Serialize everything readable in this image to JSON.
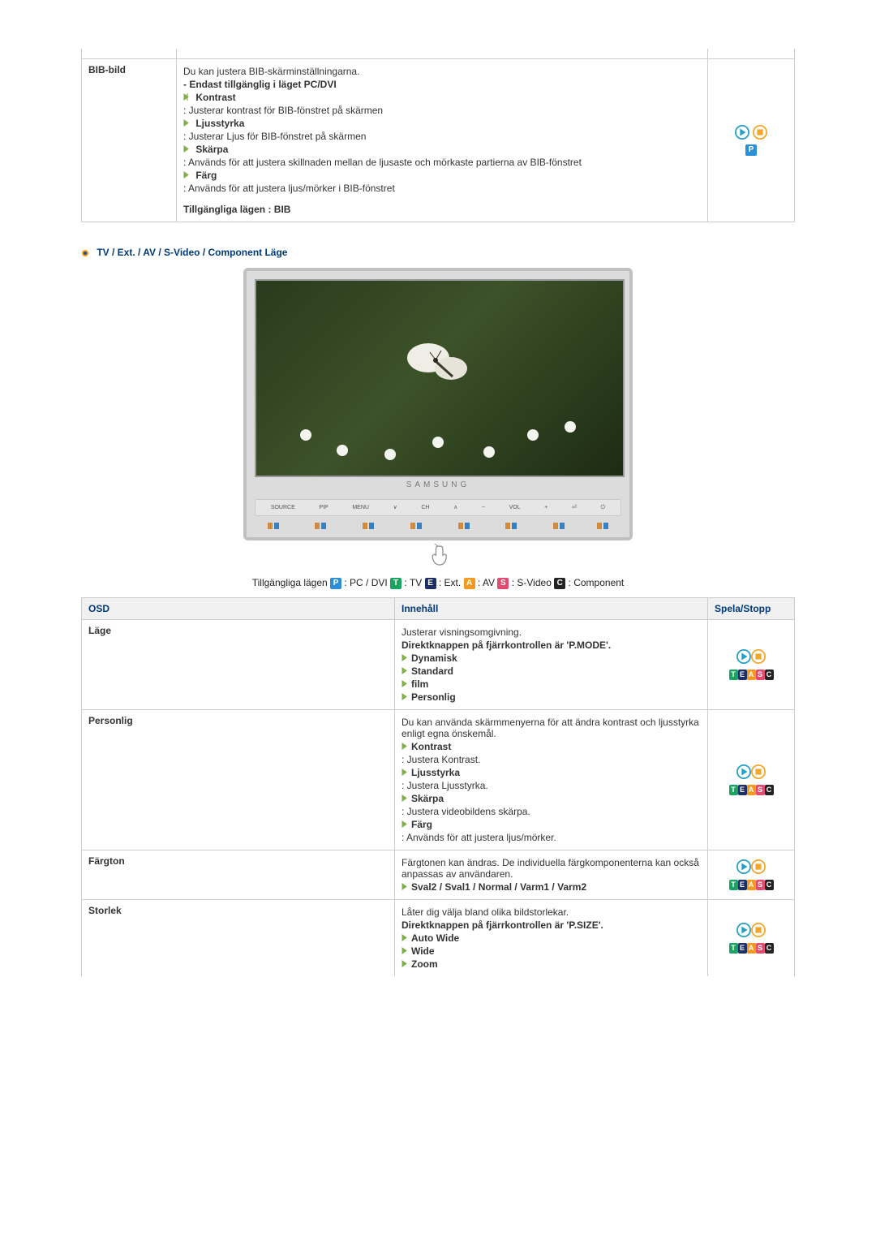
{
  "top_table": {
    "row1": {
      "label": "BIB-bild",
      "intro": "Du kan justera BIB-skärminställningarna.",
      "only_mode_bold": "- Endast tillgänglig i läget PC/DVI",
      "items": [
        {
          "title": "Kontrast",
          "desc": ": Justerar kontrast för BIB-fönstret på skärmen"
        },
        {
          "title": "Ljusstyrka",
          "desc": ": Justerar Ljus för BIB-fönstret på skärmen"
        },
        {
          "title": "Skärpa",
          "desc": ": Används för att justera skillnaden mellan de ljusaste och mörkaste partierna av BIB-fönstret"
        },
        {
          "title": "Färg",
          "desc": ": Används för att justera ljus/mörker i BIB-fönstret"
        }
      ],
      "bottom_bold": "Tillgängliga lägen : BIB"
    }
  },
  "section_title": "TV / Ext. / AV / S-Video / Component Läge",
  "monitor": {
    "logo": "SAMSUNG",
    "buttons": [
      "SOURCE",
      "PIP",
      "MENU",
      "∨",
      "CH",
      "∧",
      "−",
      "VOL",
      "+",
      "⏎",
      "⏻"
    ]
  },
  "modes_line": {
    "prefix": "Tillgängliga lägen ",
    "modes": [
      {
        "letter": "P",
        "cls": "mb-P",
        "label": ": PC / DVI "
      },
      {
        "letter": "T",
        "cls": "mb-T",
        "label": ": TV "
      },
      {
        "letter": "E",
        "cls": "mb-E",
        "label": ": Ext. "
      },
      {
        "letter": "A",
        "cls": "mb-A",
        "label": ": AV "
      },
      {
        "letter": "S",
        "cls": "mb-S",
        "label": ": S-Video "
      },
      {
        "letter": "C",
        "cls": "mb-C",
        "label": ": Component"
      }
    ]
  },
  "table2": {
    "headers": {
      "c1": "OSD",
      "c2": "Innehåll",
      "c3": "Spela/Stopp"
    },
    "rows": {
      "lage": {
        "label": "Läge",
        "line1": "Justerar visningsomgivning.",
        "bold_line": "Direktknappen på fjärrkontrollen är 'P.MODE'.",
        "items": [
          "Dynamisk",
          "Standard",
          "film",
          "Personlig"
        ]
      },
      "personlig": {
        "label": "Personlig",
        "intro": "Du kan använda skärmmenyerna för att ändra kontrast och ljusstyrka enligt egna önskemål.",
        "items": [
          {
            "title": "Kontrast",
            "desc": ": Justera Kontrast."
          },
          {
            "title": "Ljusstyrka",
            "desc": ": Justera Ljusstyrka."
          },
          {
            "title": "Skärpa",
            "desc": ": Justera videobildens skärpa."
          },
          {
            "title": "Färg",
            "desc": ": Används för att justera ljus/mörker."
          }
        ]
      },
      "fargton": {
        "label": "Färgton",
        "intro": "Färgtonen kan ändras. De individuella färgkomponenterna kan också anpassas av användaren.",
        "bold_items": "Sval2 / Sval1 / Normal / Varm1 / Varm2"
      },
      "storlek": {
        "label": "Storlek",
        "intro": "Låter dig välja bland olika bildstorlekar.",
        "bold_line": "Direktknappen på fjärrkontrollen är 'P.SIZE'.",
        "items": [
          "Auto Wide",
          "Wide",
          "Zoom"
        ]
      }
    }
  }
}
